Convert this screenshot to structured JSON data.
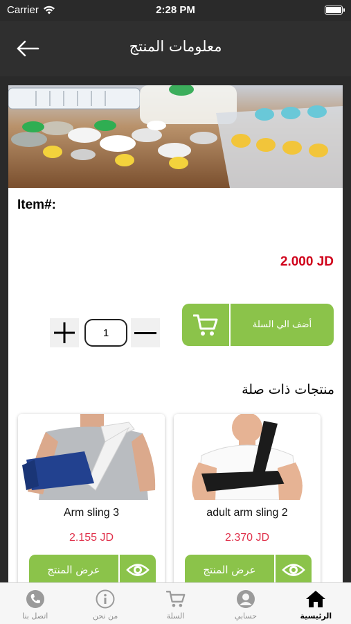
{
  "status_bar": {
    "carrier": "Carrier",
    "time": "2:28 PM"
  },
  "header": {
    "title": "معلومات المنتج"
  },
  "product": {
    "item_label": "Item#:",
    "price": "2.000 JD",
    "quantity": "1",
    "add_to_cart_label": "أضف الي السلة"
  },
  "related": {
    "title": "منتجات ذات صلة",
    "items": [
      {
        "name": "adult arm sling 2",
        "price": "2.370 JD",
        "view_label": "عرض المنتج"
      },
      {
        "name": "Arm sling 3",
        "price": "2.155 JD",
        "view_label": "عرض المنتج"
      }
    ]
  },
  "tabbar": {
    "items": [
      {
        "label": "الرئيسية",
        "icon": "home-icon",
        "active": true
      },
      {
        "label": "حسابي",
        "icon": "user-icon",
        "active": false
      },
      {
        "label": "السلة",
        "icon": "cart-icon",
        "active": false
      },
      {
        "label": "من نحن",
        "icon": "info-icon",
        "active": false
      },
      {
        "label": "اتصل بنا",
        "icon": "phone-icon",
        "active": false
      }
    ]
  },
  "colors": {
    "accent": "#8bc34a",
    "price_red": "#d0021b",
    "header_bg": "#2f2f2f"
  }
}
